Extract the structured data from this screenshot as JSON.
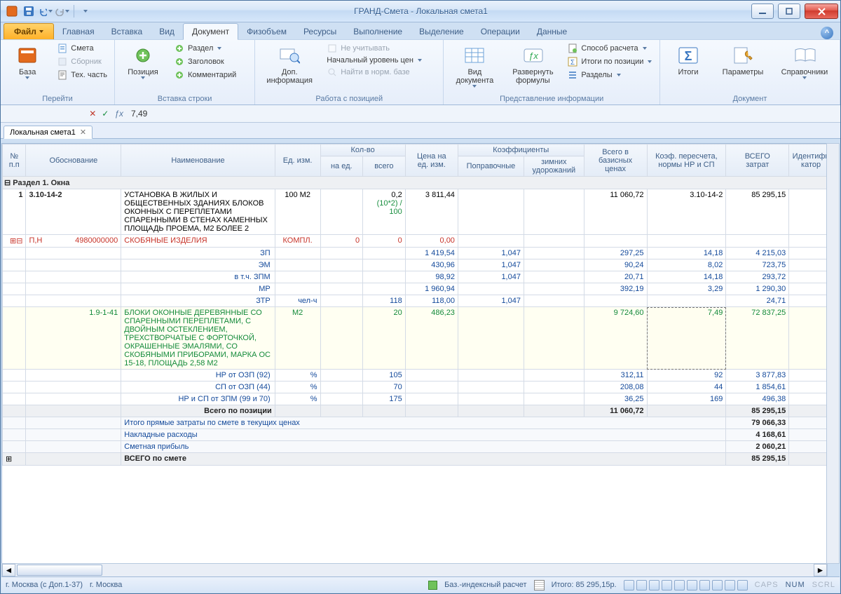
{
  "window": {
    "title": "ГРАНД-Смета - Локальная смета1"
  },
  "ribbon": {
    "file": "Файл",
    "tabs": [
      "Главная",
      "Вставка",
      "Вид",
      "Документ",
      "Физобъем",
      "Ресурсы",
      "Выполнение",
      "Выделение",
      "Операции",
      "Данные"
    ],
    "active_tab": 3,
    "groups": {
      "go": {
        "title": "Перейти",
        "base": "База",
        "smeta": "Смета",
        "sbornik": "Сборник",
        "tech": "Тех. часть"
      },
      "insert": {
        "title": "Вставка строки",
        "position": "Позиция",
        "section": "Раздел",
        "header": "Заголовок",
        "comment": "Комментарий"
      },
      "work": {
        "title": "Работа с позицией",
        "dopinfo": "Доп.\nинформация",
        "ignore": "Не учитывать",
        "price_level": "Начальный уровень цен",
        "find_norm": "Найти в норм. базе"
      },
      "present": {
        "title": "Представление информации",
        "view_doc": "Вид\nдокумента",
        "expand": "Развернуть\nформулы",
        "calc_mode": "Способ расчета",
        "pos_totals": "Итоги по позиции",
        "sections": "Разделы"
      },
      "doc": {
        "title": "Документ",
        "totals": "Итоги",
        "params": "Параметры",
        "refs": "Справочники"
      }
    }
  },
  "formula": {
    "value": "7,49"
  },
  "sheet_tab": "Локальная смета1",
  "columns": {
    "num": "№\nп.п",
    "basis": "Обоснование",
    "name": "Наименование",
    "unit": "Ед. изм.",
    "qty": "Кол-во",
    "qty_per": "на ед.",
    "qty_total": "всего",
    "price": "Цена на\nед. изм.",
    "coeff": "Коэффициенты",
    "coeff_corr": "Поправочные",
    "coeff_winter": "зимних\nудорожаний",
    "total_base": "Всего в\nбазисных\nценах",
    "recalc": "Коэф. пересчета,\nнормы НР и СП",
    "total": "ВСЕГО\nзатрат",
    "ident": "Идентифи\nкатор"
  },
  "section1": "Раздел 1. Окна",
  "row_main": {
    "num": "1",
    "basis": "3.10-14-2",
    "name": "УСТАНОВКА В ЖИЛЫХ И ОБЩЕСТВЕННЫХ ЗДАНИЯХ БЛОКОВ ОКОННЫХ С ПЕРЕПЛЕТАМИ СПАРЕННЫМИ В СТЕНАХ КАМЕННЫХ ПЛОЩАДЬ ПРОЕМА, М2 БОЛЕЕ 2",
    "unit": "100 М2",
    "qty_total": "0,2",
    "qty_formula": "(10*2) / 100",
    "price": "3 811,44",
    "total_base": "11 060,72",
    "recalc": "3.10-14-2",
    "total": "85 295,15"
  },
  "row_pn": {
    "mark": "П,Н",
    "basis": "4980000000",
    "name": "СКОБЯНЫЕ ИЗДЕЛИЯ",
    "unit": "КОМПЛ.",
    "qty_per": "0",
    "qty_total": "0",
    "price": "0,00"
  },
  "sub_rows": [
    {
      "name": "ЗП",
      "price": "1 419,54",
      "coeff": "1,047",
      "base": "297,25",
      "rec": "14,18",
      "tot": "4 215,03"
    },
    {
      "name": "ЭМ",
      "price": "430,96",
      "coeff": "1,047",
      "base": "90,24",
      "rec": "8,02",
      "tot": "723,75"
    },
    {
      "name": "в т.ч. ЗПМ",
      "price": "98,92",
      "coeff": "1,047",
      "base": "20,71",
      "rec": "14,18",
      "tot": "293,72"
    },
    {
      "name": "МР",
      "price": "1 960,94",
      "coeff": "",
      "base": "392,19",
      "rec": "3,29",
      "tot": "1 290,30"
    },
    {
      "name": "ЗТР",
      "unit": "чел-ч",
      "qty": "118",
      "price": "118,00",
      "coeff": "1,047",
      "base": "",
      "rec": "",
      "tot": "24,71"
    }
  ],
  "row_green": {
    "basis": "1.9-1-41",
    "name": "БЛОКИ ОКОННЫЕ ДЕРЕВЯННЫЕ СО СПАРЕННЫМИ ПЕРЕПЛЕТАМИ, С ДВОЙНЫМ ОСТЕКЛЕНИЕМ, ТРЕХСТВОРЧАТЫЕ С ФОРТОЧКОЙ, ОКРАШЕННЫЕ ЭМАЛЯМИ, СО СКОБЯНЫМИ ПРИБОРАМИ, МАРКА ОС 15-18, ПЛОЩАДЬ 2,58 М2",
    "unit": "М2",
    "qty": "20",
    "price": "486,23",
    "base": "9 724,60",
    "rec": "7,49",
    "tot": "72 837,25"
  },
  "percent_rows": [
    {
      "name": "НР от ОЗП (92)",
      "unit": "%",
      "qty": "105",
      "base": "312,11",
      "rec": "92",
      "tot": "3 877,83"
    },
    {
      "name": "СП от ОЗП (44)",
      "unit": "%",
      "qty": "70",
      "base": "208,08",
      "rec": "44",
      "tot": "1 854,61"
    },
    {
      "name": "НР и СП от ЗПМ (99 и 70)",
      "unit": "%",
      "qty": "175",
      "base": "36,25",
      "rec": "169",
      "tot": "496,38"
    }
  ],
  "pos_total": {
    "label": "Всего по позиции",
    "base": "11 060,72",
    "tot": "85 295,15"
  },
  "summary": [
    {
      "name": "Итого прямые затраты по смете в текущих ценах",
      "tot": "79 066,33"
    },
    {
      "name": "Накладные расходы",
      "tot": "4 168,61"
    },
    {
      "name": "Сметная прибыль",
      "tot": "2 060,21"
    }
  ],
  "grand_total": {
    "name": "ВСЕГО по смете",
    "tot": "85 295,15"
  },
  "status": {
    "region1": "г. Москва (с Доп.1-37)",
    "region2": "г. Москва",
    "calc_mode": "Баз.-индексный расчет",
    "total_label": "Итого: 85 295,15р.",
    "caps": "CAPS",
    "num": "NUM",
    "scrl": "SCRL"
  }
}
